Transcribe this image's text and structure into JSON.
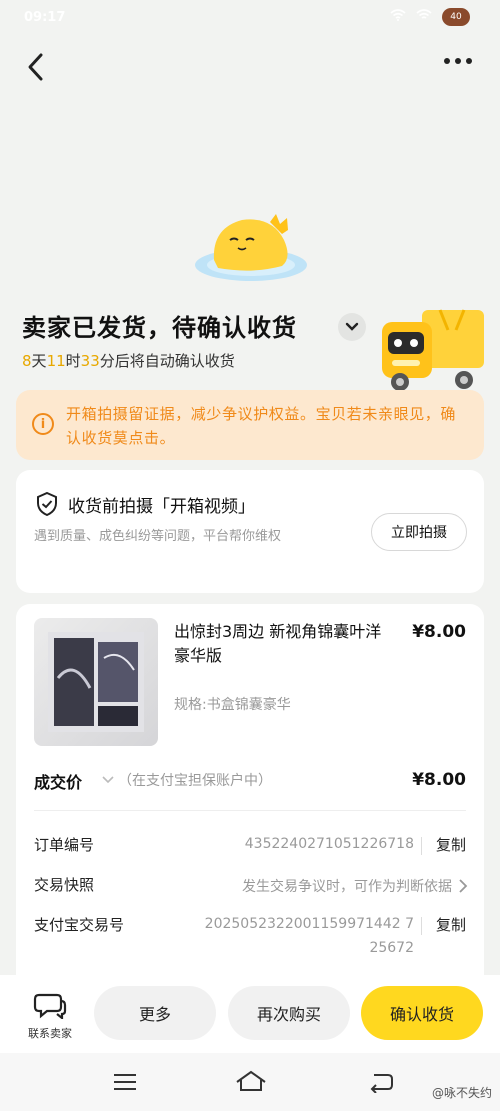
{
  "status_bar": {
    "time": "09:17",
    "battery": "40"
  },
  "header": {
    "back_icon": "chevron-left-icon",
    "more_icon": "more-dots-icon"
  },
  "status": {
    "title": "卖家已发货，待确认收货",
    "countdown": {
      "days": "8",
      "days_unit": "天",
      "hours": "11",
      "hours_unit": "时",
      "minutes": "33",
      "suffix": "分后将自动确认收货"
    }
  },
  "notice": {
    "text": "开箱拍摄留证据，减少争议护权益。宝贝若未亲眼见，确认收货莫点击。"
  },
  "video_card": {
    "title": "收货前拍摄「开箱视频」",
    "desc": "遇到质量、成色纠纷等问题，平台帮你维权",
    "button": "立即拍摄"
  },
  "product": {
    "name": "出惊封3周边 新视角锦囊叶洋豪华版",
    "price": "¥8.00",
    "spec": "规格:书盒锦囊豪华"
  },
  "deal": {
    "label": "成交价",
    "note": "（在支付宝担保账户中）",
    "price": "¥8.00"
  },
  "order_rows": [
    {
      "label": "订单编号",
      "value": "4352240271051226718",
      "action": "复制"
    },
    {
      "label": "交易快照",
      "value": "发生交易争议时，可作为判断依据"
    },
    {
      "label": "支付宝交易号",
      "value_line1": "2025052322001159971442 7",
      "value_line2": "25672",
      "action": "复制"
    }
  ],
  "bottom_bar": {
    "contact_label": "联系卖家",
    "more": "更多",
    "rebuy": "再次购买",
    "confirm": "确认收货"
  },
  "watermark": "@咏不失约",
  "colors": {
    "accent": "#ffd81f",
    "notice_bg": "#fde8cf",
    "notice_text": "#f08a1a",
    "countdown": "#e8a800"
  }
}
